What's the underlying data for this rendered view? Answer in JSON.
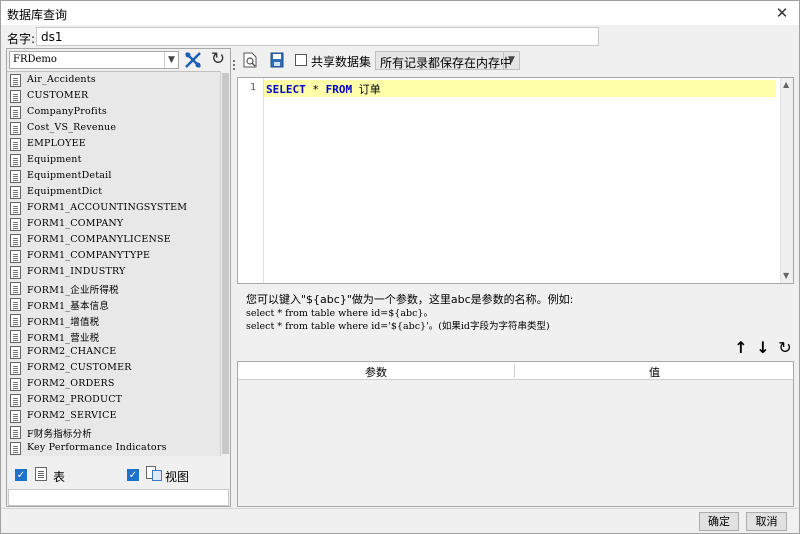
{
  "window": {
    "title": "数据库查询",
    "close_symbol": "✕"
  },
  "name_field": {
    "label": "名字:",
    "value": "ds1"
  },
  "left_panel": {
    "connection": "FRDemo",
    "tables": [
      "Air_Accidents",
      "CUSTOMER",
      "CompanyProfits",
      "Cost_VS_Revenue",
      "EMPLOYEE",
      "Equipment",
      "EquipmentDetail",
      "EquipmentDict",
      "FORM1_ACCOUNTINGSYSTEM",
      "FORM1_COMPANY",
      "FORM1_COMPANYLICENSE",
      "FORM1_COMPANYTYPE",
      "FORM1_INDUSTRY",
      "FORM1_企业所得税",
      "FORM1_基本信息",
      "FORM1_增值税",
      "FORM1_营业税",
      "FORM2_CHANCE",
      "FORM2_CUSTOMER",
      "FORM2_ORDERS",
      "FORM2_PRODUCT",
      "FORM2_SERVICE",
      "F财务指标分析",
      "Key Performance Indicators"
    ],
    "filter_table_label": "表",
    "filter_view_label": "视图",
    "filter_table_checked": true,
    "filter_view_checked": true
  },
  "toolbar": {
    "share_label": "共享数据集",
    "share_checked": false,
    "mode_value": "所有记录都保存在内存中"
  },
  "editor": {
    "line_number": "1",
    "sql": {
      "select": "SELECT",
      "star": "*",
      "from": "FROM",
      "table": "订单"
    }
  },
  "hint": {
    "line1": "您可以键入\"${abc}\"做为一个参数，这里abc是参数的名称。例如:",
    "line2": "select * from table where id=${abc}。",
    "line3": "select * from table where id='${abc}'。(如果id字段为字符串类型)"
  },
  "params": {
    "col_param": "参数",
    "col_value": "值"
  },
  "footer": {
    "ok": "确定",
    "cancel": "取消"
  }
}
